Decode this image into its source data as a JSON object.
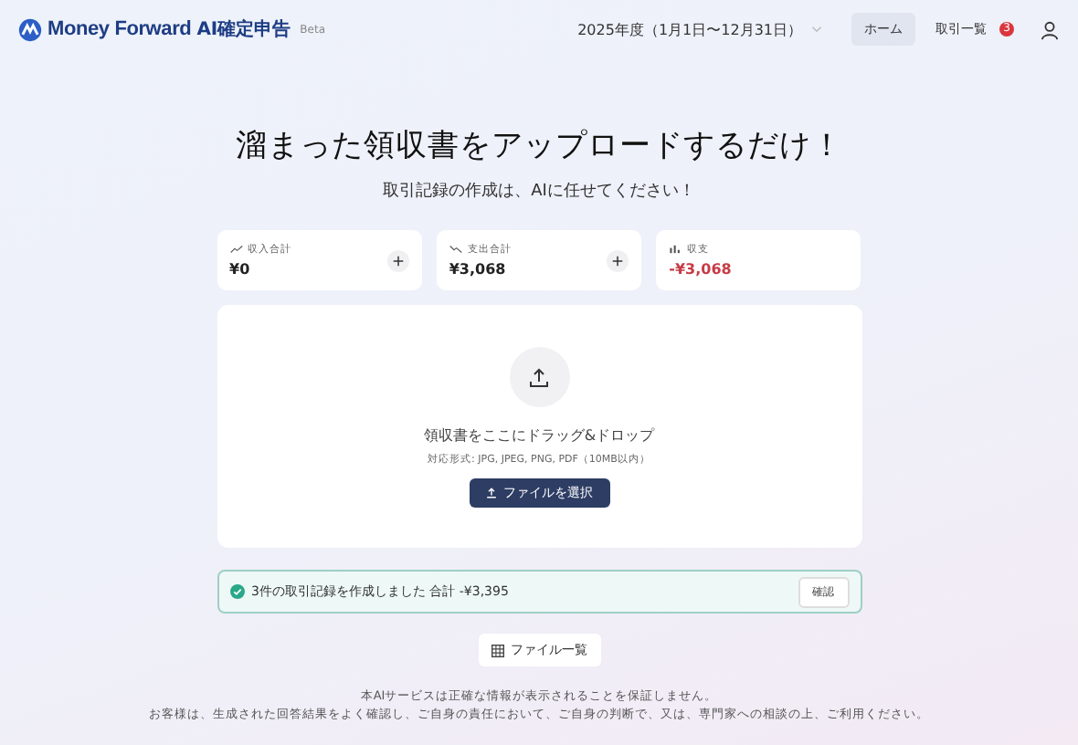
{
  "header": {
    "brand": "Money Forward",
    "product": "AI確定申告",
    "badge": "Beta",
    "fiscal_year": "2025年度（1月1日〜12月31日）",
    "nav": [
      {
        "label": "ホーム",
        "selected": true
      },
      {
        "label": "取引一覧",
        "selected": false,
        "count": "3"
      }
    ]
  },
  "hero": {
    "title": "溜まった領収書をアップロードするだけ！",
    "subtitle": "取引記録の作成は、AIに任せてください！"
  },
  "stats": [
    {
      "kind": "income",
      "label": "収入合計",
      "value": "¥0",
      "negative": false,
      "addable": true
    },
    {
      "kind": "expense",
      "label": "支出合計",
      "value": "¥3,068",
      "negative": false,
      "addable": true
    },
    {
      "kind": "balance",
      "label": "収支",
      "value": "-¥3,068",
      "negative": true,
      "addable": false
    }
  ],
  "upload": {
    "prompt": "領収書をここにドラッグ&ドロップ",
    "formats": "対応形式: JPG, JPEG, PNG, PDF（10MB以内）",
    "button": "ファイルを選択"
  },
  "notice": {
    "message": "3件の取引記録を作成しました 合計 -¥3,395",
    "button": "確認"
  },
  "file_list_button": "ファイル一覧",
  "footer": [
    "本AIサービスは正確な情報が表示されることを保証しません。",
    "お客様は、生成された回答結果をよく確認し、ご自身の責任において、ご自身の判断で、又は、専門家への相談の上、ご利用ください。"
  ]
}
